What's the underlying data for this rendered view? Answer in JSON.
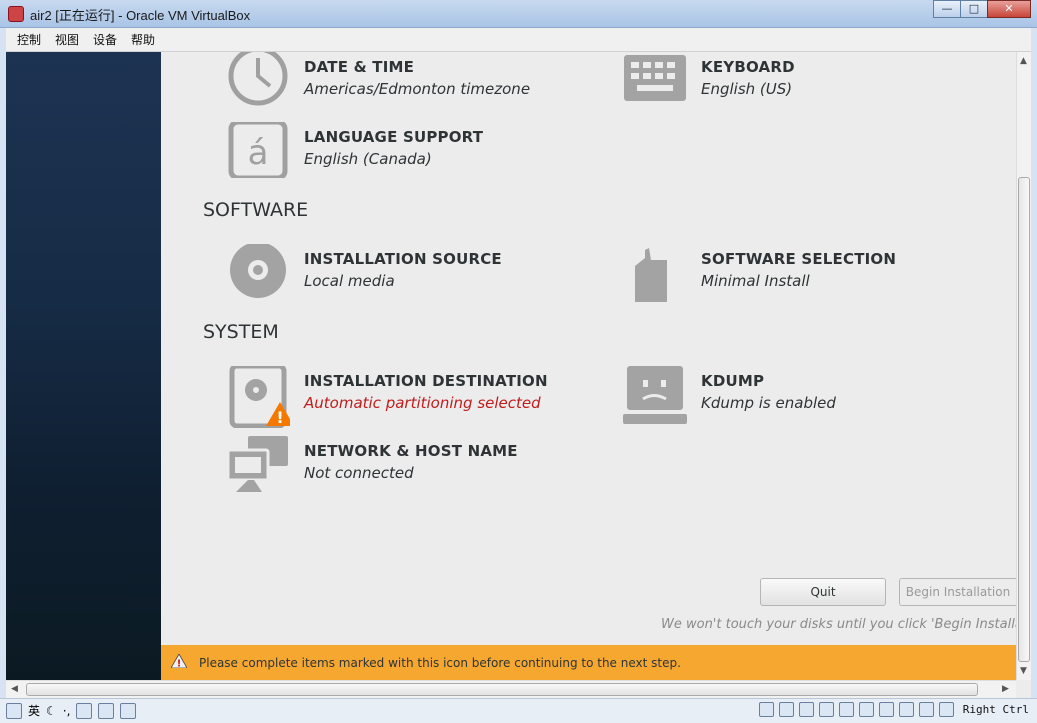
{
  "window": {
    "title": "air2 [正在运行] - Oracle VM VirtualBox"
  },
  "menu": [
    "控制",
    "视图",
    "设备",
    "帮助"
  ],
  "sections": {
    "software": "SOFTWARE",
    "system": "SYSTEM"
  },
  "spokes": {
    "date_time": {
      "label": "DATE & TIME",
      "status": "Americas/Edmonton timezone"
    },
    "keyboard": {
      "label": "KEYBOARD",
      "status": "English (US)"
    },
    "language": {
      "label": "LANGUAGE SUPPORT",
      "status": "English (Canada)"
    },
    "install_source": {
      "label": "INSTALLATION SOURCE",
      "status": "Local media"
    },
    "software_selection": {
      "label": "SOFTWARE SELECTION",
      "status": "Minimal Install"
    },
    "install_dest": {
      "label": "INSTALLATION DESTINATION",
      "status": "Automatic partitioning selected"
    },
    "kdump": {
      "label": "KDUMP",
      "status": "Kdump is enabled"
    },
    "network": {
      "label": "NETWORK & HOST NAME",
      "status": "Not connected"
    }
  },
  "buttons": {
    "quit": "Quit",
    "begin": "Begin Installation"
  },
  "note": "We won't touch your disks until you click 'Begin Installation'.",
  "warning": "Please complete items marked with this icon before continuing to the next step.",
  "statusbar": {
    "ime": "英",
    "host_key": "Right Ctrl"
  },
  "colors": {
    "warning_bar": "#f6a730",
    "warning_text": "#c01c1c",
    "sidebar": "#162b45"
  }
}
